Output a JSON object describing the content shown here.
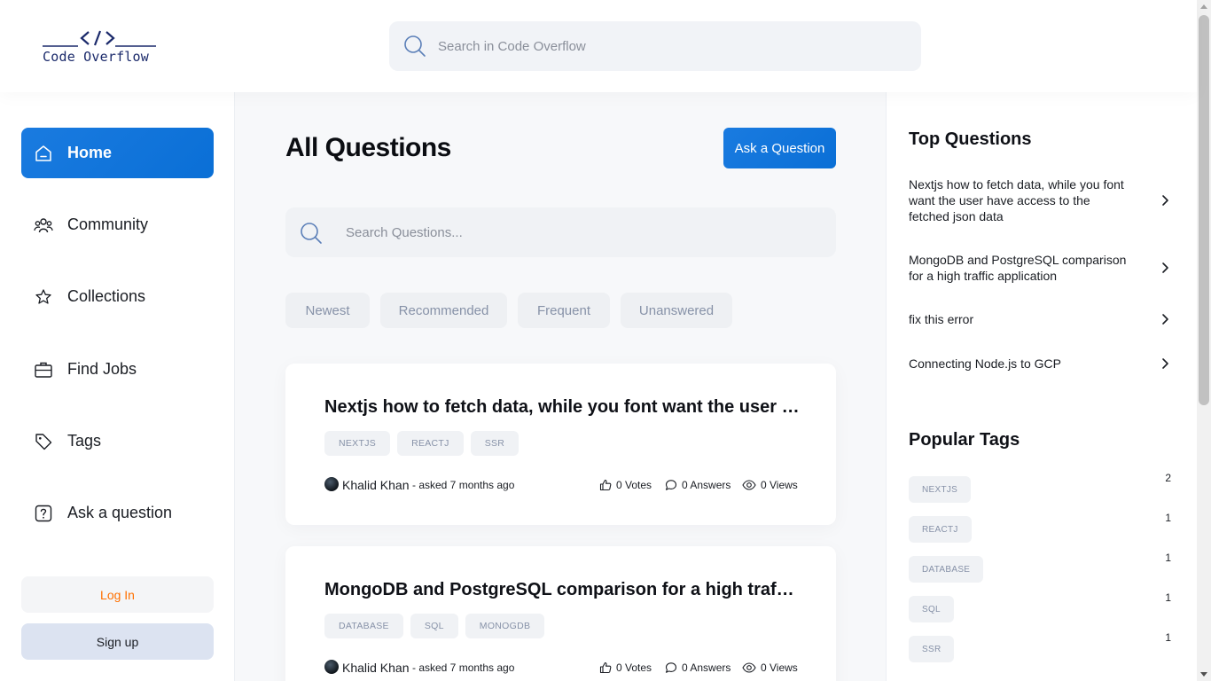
{
  "brand": {
    "name": "Code Overflow",
    "icon": "code-brackets-icon"
  },
  "header": {
    "search_placeholder": "Search in Code Overflow"
  },
  "sidebar": {
    "items": [
      {
        "label": "Home",
        "icon": "home-icon",
        "active": true
      },
      {
        "label": "Community",
        "icon": "users-icon",
        "active": false
      },
      {
        "label": "Collections",
        "icon": "star-icon",
        "active": false
      },
      {
        "label": "Find Jobs",
        "icon": "briefcase-icon",
        "active": false
      },
      {
        "label": "Tags",
        "icon": "tag-icon",
        "active": false
      },
      {
        "label": "Ask a question",
        "icon": "question-icon",
        "active": false
      }
    ],
    "login_label": "Log In",
    "signup_label": "Sign up"
  },
  "main": {
    "title": "All Questions",
    "ask_label": "Ask a Question",
    "search_placeholder": "Search Questions...",
    "filters": [
      "Newest",
      "Recommended",
      "Frequent",
      "Unanswered"
    ],
    "questions": [
      {
        "title": "Nextjs how to fetch data, while you font want the user have access to the fetched json data",
        "tags": [
          "NEXTJS",
          "REACTJ",
          "SSR"
        ],
        "author": "Khalid Khan",
        "asked": "- asked 7 months ago",
        "votes": "0 Votes",
        "answers": "0 Answers",
        "views": "0 Views"
      },
      {
        "title": "MongoDB and PostgreSQL comparison for a high traffic application",
        "tags": [
          "DATABASE",
          "SQL",
          "MONOGDB"
        ],
        "author": "Khalid Khan",
        "asked": "- asked 7 months ago",
        "votes": "0 Votes",
        "answers": "0 Answers",
        "views": "0 Views"
      }
    ]
  },
  "right": {
    "top_title": "Top Questions",
    "top_questions": [
      "Nextjs how to fetch data, while you font want the user have access to the fetched json data",
      "MongoDB and PostgreSQL comparison for a high traffic application",
      "fix this error",
      "Connecting Node.js to GCP"
    ],
    "tags_title": "Popular Tags",
    "popular_tags": [
      {
        "name": "NEXTJS",
        "count": "2"
      },
      {
        "name": "REACTJ",
        "count": "1"
      },
      {
        "name": "DATABASE",
        "count": "1"
      },
      {
        "name": "SQL",
        "count": "1"
      },
      {
        "name": "SSR",
        "count": "1"
      }
    ]
  },
  "colors": {
    "primary": "#0a6fd6",
    "accent_orange": "#ff7000",
    "chip_text": "#8792a8"
  }
}
